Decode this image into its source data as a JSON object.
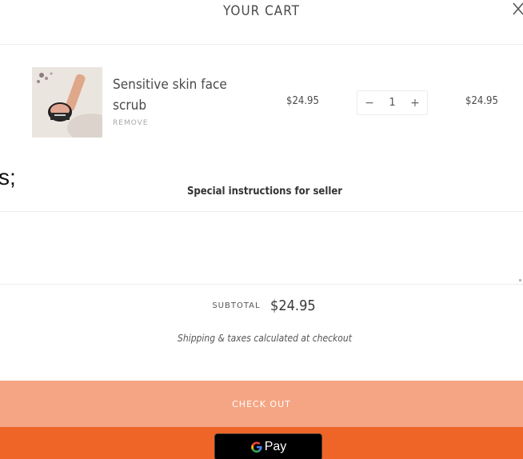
{
  "header": {
    "title": "YOUR CART"
  },
  "background_fragment": "s;",
  "line_item": {
    "name": "Sensitive skin face scrub",
    "remove_label": "REMOVE",
    "unit_price": "$24.95",
    "quantity": "1",
    "qty_decrement": "−",
    "qty_increment": "+",
    "line_total": "$24.95"
  },
  "notes": {
    "label": "Special instructions for seller",
    "value": ""
  },
  "subtotal": {
    "label": "SUBTOTAL",
    "value": "$24.95"
  },
  "shipping_note": "Shipping & taxes calculated at checkout",
  "checkout": {
    "label": "CHECK OUT"
  },
  "gpay": {
    "label": "Pay"
  },
  "colors": {
    "checkout_bg": "#f5a583",
    "pay_bar_bg": "#ef6528",
    "gpay_bg": "#000000"
  }
}
